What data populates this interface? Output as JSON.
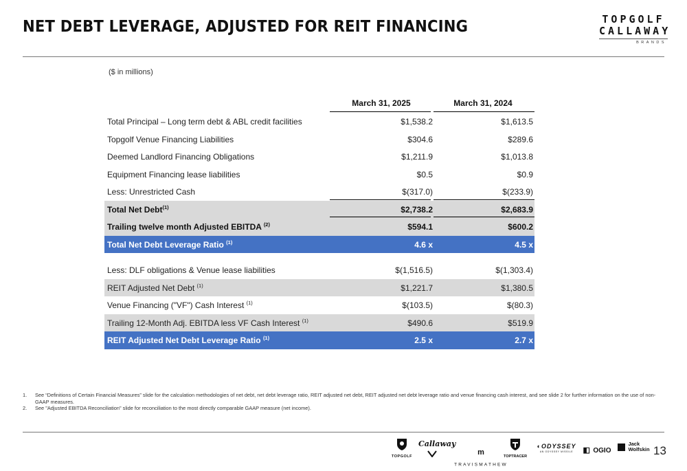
{
  "header": {
    "title": "NET DEBT LEVERAGE, ADJUSTED FOR REIT FINANCING",
    "logo": {
      "line1": "TOPGOLF",
      "line2": "CALLAWAY",
      "line3": "BRANDS"
    }
  },
  "units_note": "($ in millions)",
  "table": {
    "columns": [
      "March 31, 2025",
      "March 31, 2024"
    ],
    "rows": [
      {
        "label": "Total Principal – Long term debt & ABL credit facilities",
        "sup": "",
        "v2025": "$1,538.2",
        "v2024": "$1,613.5"
      },
      {
        "label": "Topgolf Venue Financing Liabilities",
        "sup": "",
        "v2025": "$304.6",
        "v2024": "$289.6"
      },
      {
        "label": "Deemed Landlord Financing Obligations",
        "sup": "",
        "v2025": "$1,211.9",
        "v2024": "$1,013.8"
      },
      {
        "label": "Equipment Financing lease liabilities",
        "sup": "",
        "v2025": "$0.5",
        "v2024": "$0.9"
      },
      {
        "label": "Less: Unrestricted Cash",
        "sup": "",
        "v2025": "$(317.0)",
        "v2024": "$(233.9)"
      },
      {
        "label": "Total Net Debt",
        "sup": "(1)",
        "v2025": "$2,738.2",
        "v2024": "$2,683.9"
      },
      {
        "label": "Trailing twelve month Adjusted EBITDA",
        "sup": "(2)",
        "v2025": "$594.1",
        "v2024": "$600.2"
      },
      {
        "label": "Total Net Debt Leverage Ratio",
        "sup": "(1)",
        "v2025": "4.6 x",
        "v2024": "4.5 x"
      },
      {
        "label": "Less: DLF obligations & Venue lease liabilities",
        "sup": "",
        "v2025": "$(1,516.5)",
        "v2024": "$(1,303.4)"
      },
      {
        "label": "REIT Adjusted Net Debt",
        "sup": "(1)",
        "v2025": "$1,221.7",
        "v2024": "$1,380.5"
      },
      {
        "label": "Venue Financing (\"VF\") Cash Interest",
        "sup": "(1)",
        "v2025": "$(103.5)",
        "v2024": "$(80.3)"
      },
      {
        "label": "Trailing 12-Month Adj. EBITDA less VF Cash Interest",
        "sup": "(1)",
        "v2025": "$490.6",
        "v2024": "$519.9"
      },
      {
        "label": "REIT Adjusted Net Debt Leverage Ratio",
        "sup": "(1)",
        "v2025": "2.5 x",
        "v2024": "2.7 x"
      }
    ]
  },
  "footnotes": [
    {
      "num": "1.",
      "text": "See “Definitions of Certain Financial Measures” slide for the calculation methodologies of net debt, net debt leverage ratio, REIT adjusted net debt, REIT adjusted net debt leverage ratio and venue financing cash interest, and see slide 2 for further information on the use of non-GAAP measures."
    },
    {
      "num": "2.",
      "text": "See \"Adjusted EBITDA Reconciliation\" slide for reconciliation to the most directly comparable GAAP measure (net income)."
    }
  ],
  "brands": {
    "topgolf": "TOPGOLF",
    "callaway": "Callaway",
    "travismathew": "TRAVISMATHEW",
    "toptracer": "TOPTRACER",
    "odyssey": "ODYSSEY",
    "odyssey_sub": "AN ODYSSEY MISSILE",
    "ogio": "OGIO",
    "jack_wolfskin_1": "Jack",
    "jack_wolfskin_2": "Wolfskin"
  },
  "page_number": "13"
}
